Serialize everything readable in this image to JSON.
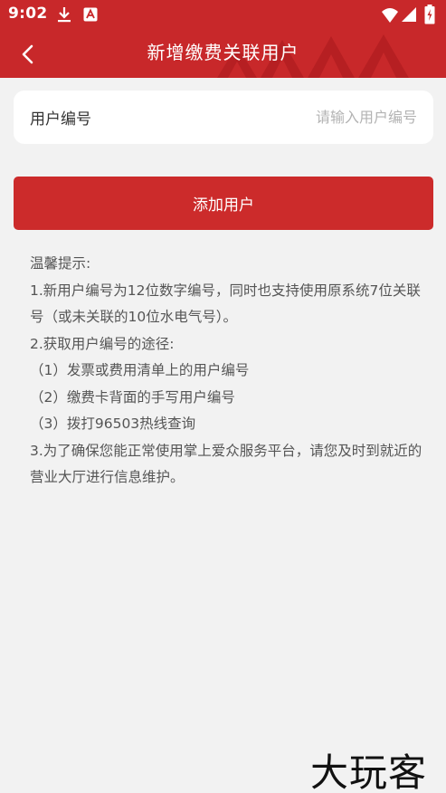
{
  "status_bar": {
    "time": "9:02",
    "icons": [
      "download-icon",
      "a-notification-icon",
      "wifi-icon",
      "signal-icon",
      "battery-icon"
    ]
  },
  "app_bar": {
    "title": "新增缴费关联用户",
    "back_icon": "chevron-left-icon"
  },
  "form": {
    "user_id_label": "用户编号",
    "user_id_value": "",
    "user_id_placeholder": "请输入用户编号"
  },
  "actions": {
    "add_user_label": "添加用户"
  },
  "tips": {
    "heading": "温馨提示:",
    "lines": [
      "1.新用户编号为12位数字编号，同时也支持使用原系统7位关联号（或未关联的10位水电气号）。",
      "2.获取用户编号的途径:",
      "（1）发票或费用清单上的用户编号",
      "（2）缴费卡背面的手写用户编号",
      "（3）拨打96503热线查询",
      "3.为了确保您能正常使用掌上爱众服务平台，请您及时到就近的营业大厅进行信息维护。"
    ]
  },
  "watermark": "大玩客",
  "colors": {
    "primary_red": "#c8282a",
    "button_red": "#cc2b2b",
    "background": "#f2f2f2",
    "card": "#ffffff"
  }
}
